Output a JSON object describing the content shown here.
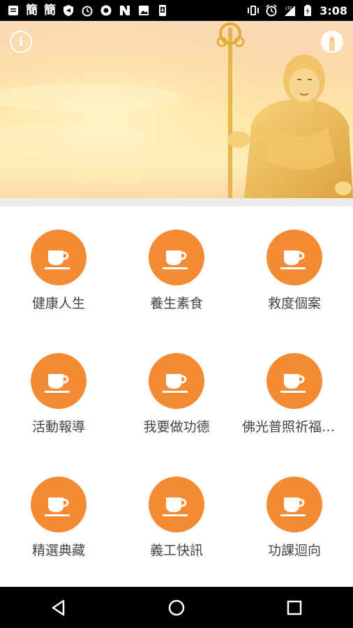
{
  "status_bar": {
    "left_icons": [
      "message-icon",
      "char-icon",
      "char-icon",
      "shield-icon",
      "alarm-icon",
      "vpn-icon",
      "nfc-icon",
      "image-icon",
      "download-icon"
    ],
    "chars": [
      "簡",
      "簡"
    ],
    "right_icons": [
      "vibrate-icon",
      "alarm-icon",
      "lte-signal-icon",
      "battery-icon"
    ],
    "time": "3:08"
  },
  "banner": {
    "info_label": "i",
    "colors": {
      "sky_top": "#fbd8b8",
      "sky_mid": "#fde6a6",
      "statue": "#e9b24a"
    }
  },
  "menu": {
    "accent": "#f58a34",
    "icon": "cup-icon",
    "items": [
      {
        "label": "健康人生"
      },
      {
        "label": "養生素食"
      },
      {
        "label": "救度個案"
      },
      {
        "label": "活動報導"
      },
      {
        "label": "我要做功德"
      },
      {
        "label": "佛光普照祈福消災"
      },
      {
        "label": "精選典藏"
      },
      {
        "label": "義工快訊"
      },
      {
        "label": "功課迴向"
      }
    ]
  },
  "nav_bar": {
    "buttons": [
      "back-icon",
      "home-icon",
      "recents-icon"
    ]
  }
}
